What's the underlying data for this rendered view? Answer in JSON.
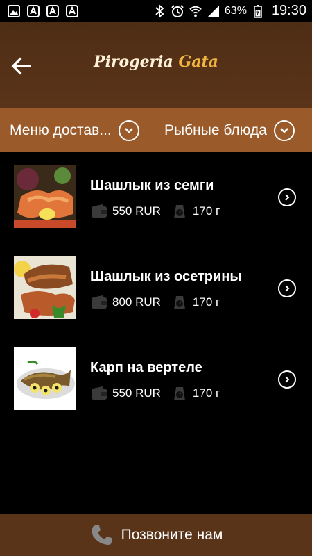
{
  "status_bar": {
    "battery_percent": "63%",
    "time": "19:30",
    "left_icons": [
      "image-icon",
      "app-icon",
      "app-icon",
      "app-icon"
    ],
    "right_icons": [
      "bluetooth-icon",
      "alarm-icon",
      "wifi-icon",
      "signal-icon",
      "battery-icon"
    ]
  },
  "header": {
    "title_part1": "Pirogeria ",
    "title_part2": "Gata",
    "back_icon": "arrow-left-icon"
  },
  "filters": {
    "menu_label": "Меню достав...",
    "category_label": "Рыбные блюда"
  },
  "items": [
    {
      "title": "Шашлык из семги",
      "price": "550 RUR",
      "weight": "170 г"
    },
    {
      "title": "Шашлык из осетрины",
      "price": "800 RUR",
      "weight": "170 г"
    },
    {
      "title": "Карп на вертеле",
      "price": "550 RUR",
      "weight": "170 г"
    }
  ],
  "call_bar": {
    "label": "Позвоните нам",
    "icon": "phone-icon"
  },
  "colors": {
    "header_bg": "#5a3419",
    "filter_bg": "#9b5a2a",
    "title_accent": "#f0b640",
    "background": "#000000"
  }
}
